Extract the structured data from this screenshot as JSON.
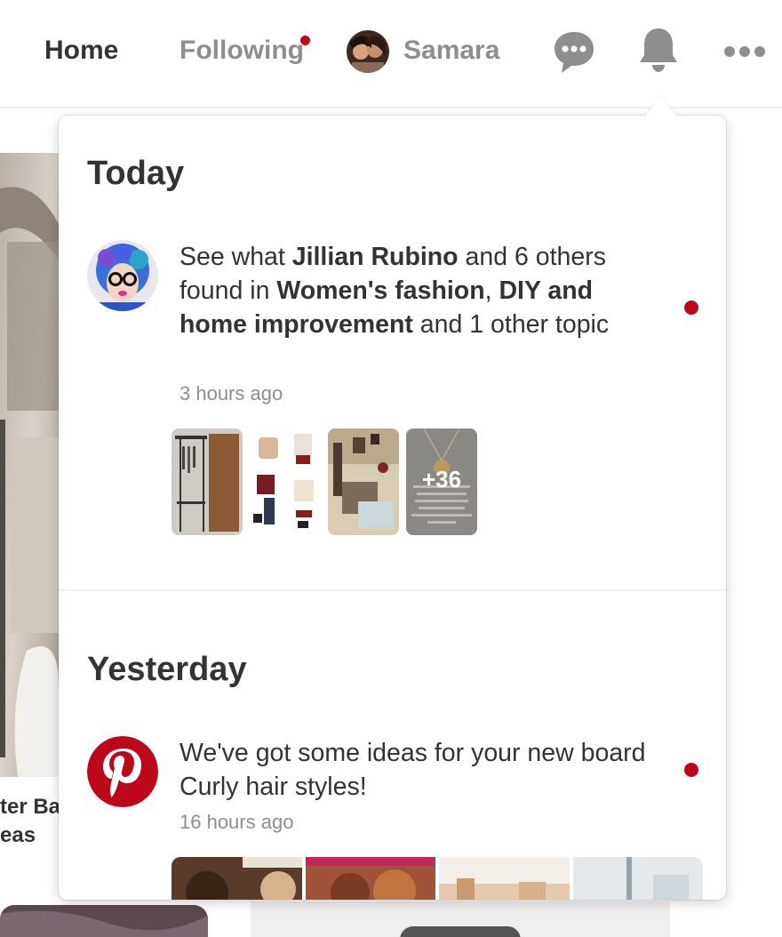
{
  "nav": {
    "home": "Home",
    "following": "Following",
    "user_name": "Samara",
    "icons": [
      "messages-icon",
      "notifications-bell-icon",
      "more-options-icon"
    ]
  },
  "background": {
    "caption_line1": "ter Ba",
    "caption_line2": "eas"
  },
  "notifications": {
    "today": {
      "heading": "Today",
      "item": {
        "prefix": "See what ",
        "user": "Jillian Rubino",
        "mid1": " and 6 others found in ",
        "topic1": "Women's fashion",
        "sep": ", ",
        "topic2": "DIY and home improvement",
        "suffix": " and 1 other topic",
        "time": "3 hours ago",
        "more_count": "+36"
      }
    },
    "yesterday": {
      "heading": "Yesterday",
      "item": {
        "text": "We've got some ideas for your new board Curly hair styles!",
        "time": "16 hours ago"
      }
    }
  },
  "colors": {
    "brand_red": "#bd081c",
    "text_dark": "#333333",
    "text_muted": "#8e8e8e"
  }
}
